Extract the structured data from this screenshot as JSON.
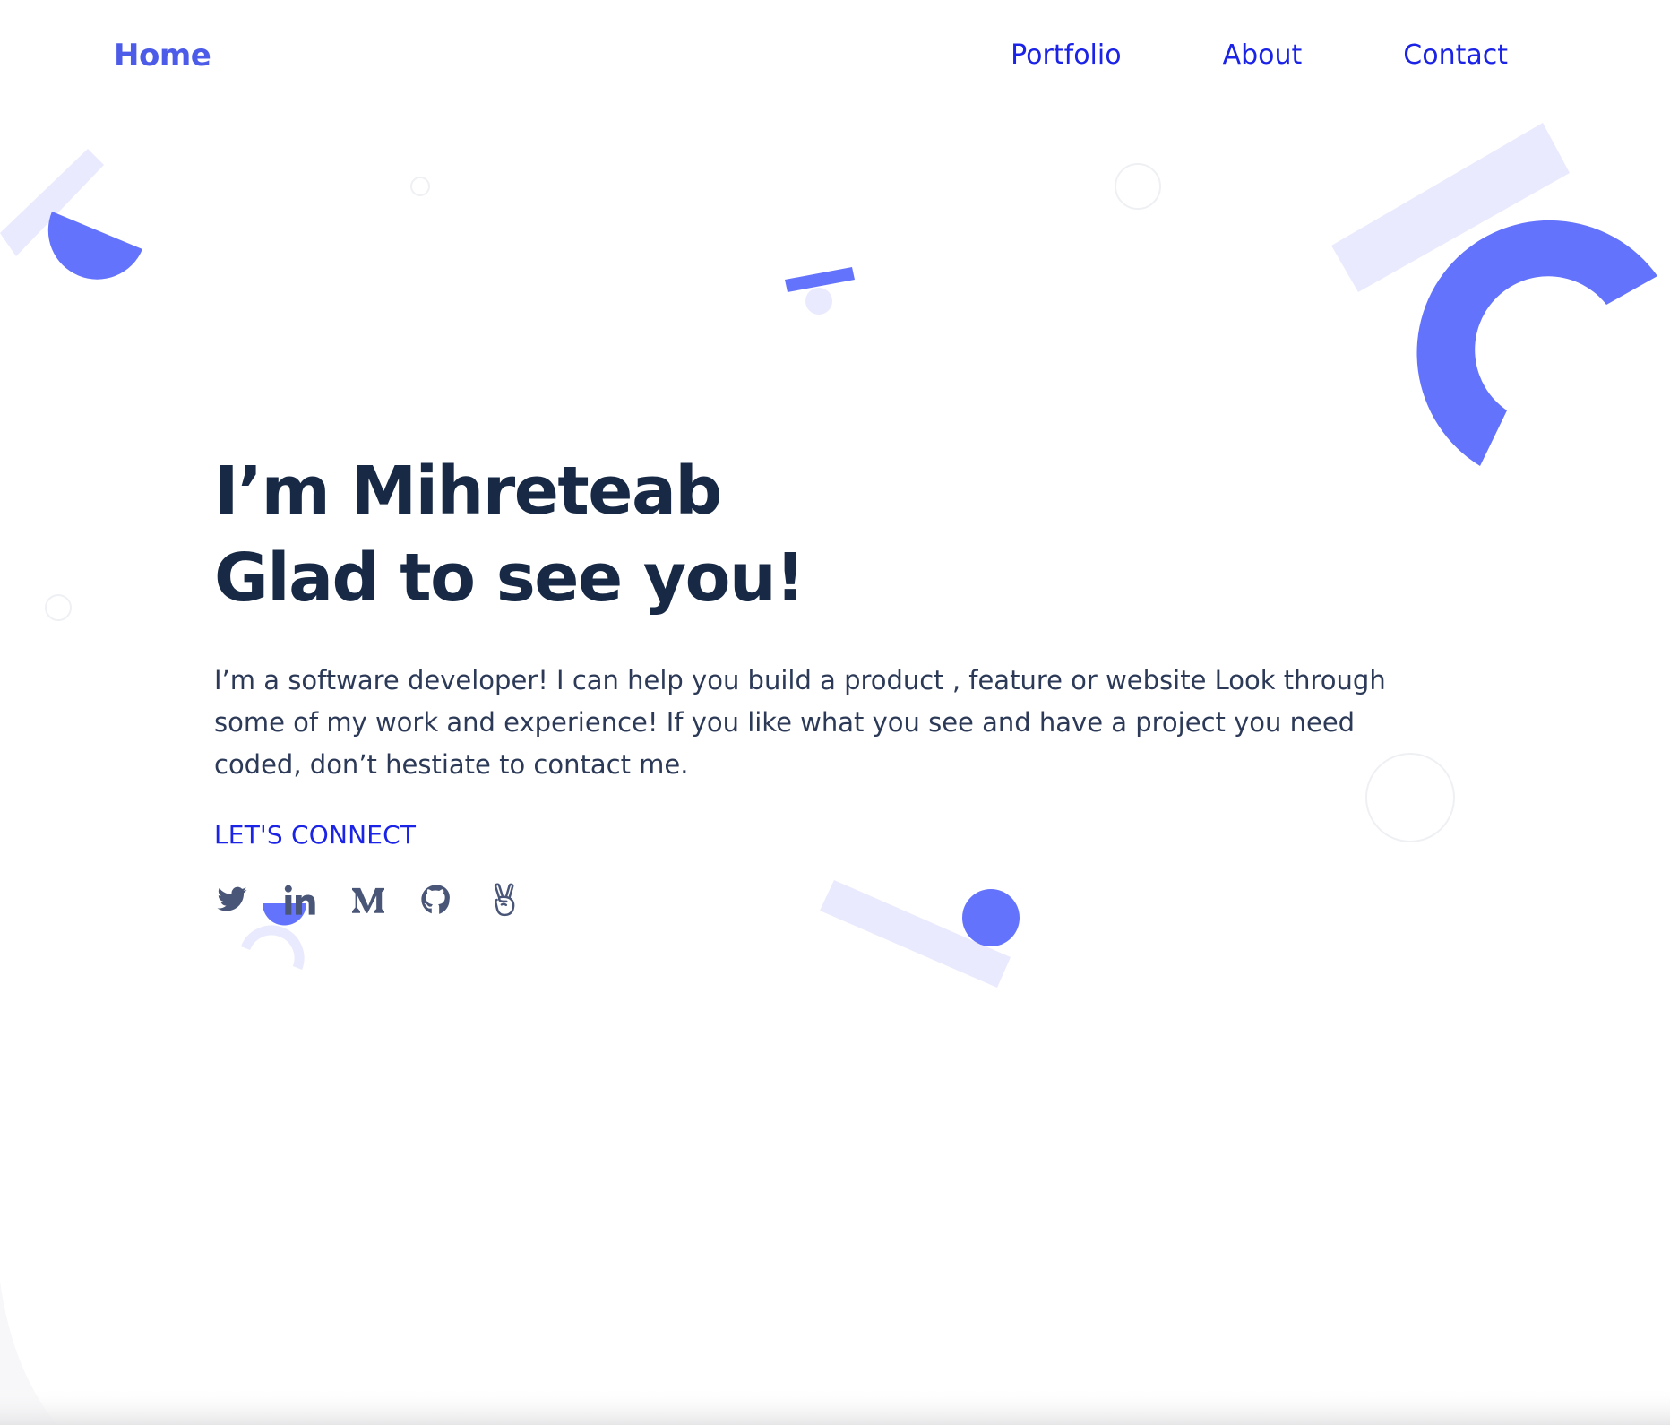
{
  "nav": {
    "home": "Home",
    "links": [
      "Portfolio",
      "About",
      "Contact"
    ]
  },
  "hero": {
    "title_line1": "I’m Mihreteab",
    "title_line2": "Glad to see you!",
    "description": "I’m a software developer! I can help you build a product , feature or website Look through some of my work and experience! If you like what you see and have a project you need coded, don’t hestiate to contact me.",
    "connect_label": "LET'S CONNECT"
  },
  "socials": [
    {
      "name": "twitter-icon"
    },
    {
      "name": "linkedin-icon"
    },
    {
      "name": "medium-icon"
    },
    {
      "name": "github-icon"
    },
    {
      "name": "angellist-icon"
    }
  ],
  "colors": {
    "accent": "#6473fb",
    "accent_light": "#e9eafd",
    "nav_link": "#1a23e6",
    "home": "#4c5ce8",
    "heading": "#172944",
    "body_text": "#2c3a58",
    "icon": "#4a5677",
    "outline_circle": "#eef0f3"
  }
}
